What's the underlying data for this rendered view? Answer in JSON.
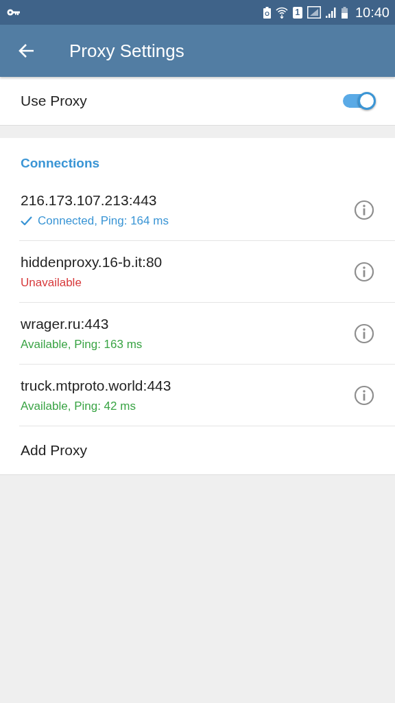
{
  "status_bar": {
    "sim_slot": "1",
    "time": "10:40"
  },
  "app_bar": {
    "title": "Proxy Settings"
  },
  "use_proxy": {
    "label": "Use Proxy",
    "on": true
  },
  "connections": {
    "header": "Connections",
    "items": [
      {
        "address": "216.173.107.213:443",
        "status": "Connected, Ping: 164 ms",
        "kind": "connected"
      },
      {
        "address": "hiddenproxy.16-b.it:80",
        "status": "Unavailable",
        "kind": "unavailable"
      },
      {
        "address": "wrager.ru:443",
        "status": "Available, Ping: 163 ms",
        "kind": "available"
      },
      {
        "address": "truck.mtproto.world:443",
        "status": "Available, Ping: 42 ms",
        "kind": "available"
      }
    ],
    "add_label": "Add Proxy"
  }
}
